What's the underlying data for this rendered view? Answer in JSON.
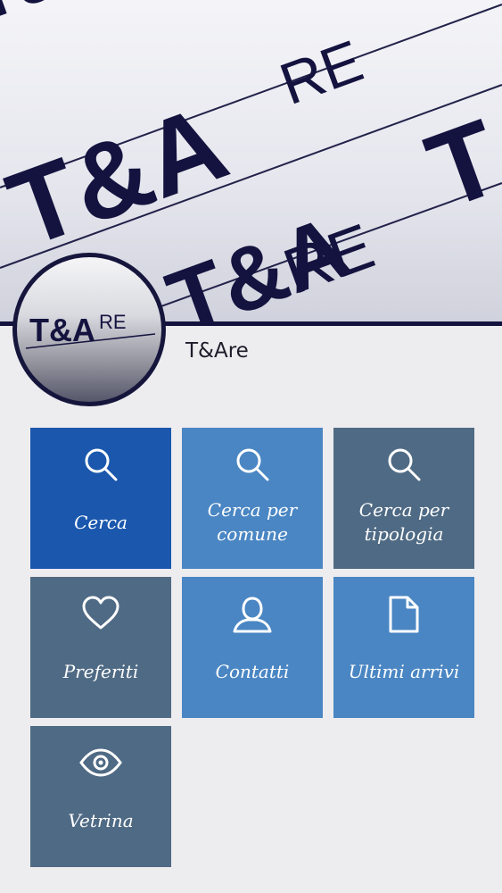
{
  "header": {
    "banner_text_1": "T&A",
    "banner_text_2": "RE",
    "logo_text_main": "T&A",
    "logo_text_sup": "RE"
  },
  "app": {
    "title": "T&Are"
  },
  "tiles": [
    {
      "label": "Cerca",
      "icon": "search-icon",
      "color": "#1a57ad"
    },
    {
      "label": "Cerca per comune",
      "icon": "search-icon",
      "color": "#4a86c3"
    },
    {
      "label": "Cerca per tipologia",
      "icon": "search-icon",
      "color": "#4f6a84"
    },
    {
      "label": "Preferiti",
      "icon": "heart-icon",
      "color": "#4f6a84"
    },
    {
      "label": "Contatti",
      "icon": "user-icon",
      "color": "#4a86c3"
    },
    {
      "label": "Ultimi arrivi",
      "icon": "document-icon",
      "color": "#4a86c3"
    },
    {
      "label": "Vetrina",
      "icon": "eye-icon",
      "color": "#4f6a84"
    }
  ]
}
